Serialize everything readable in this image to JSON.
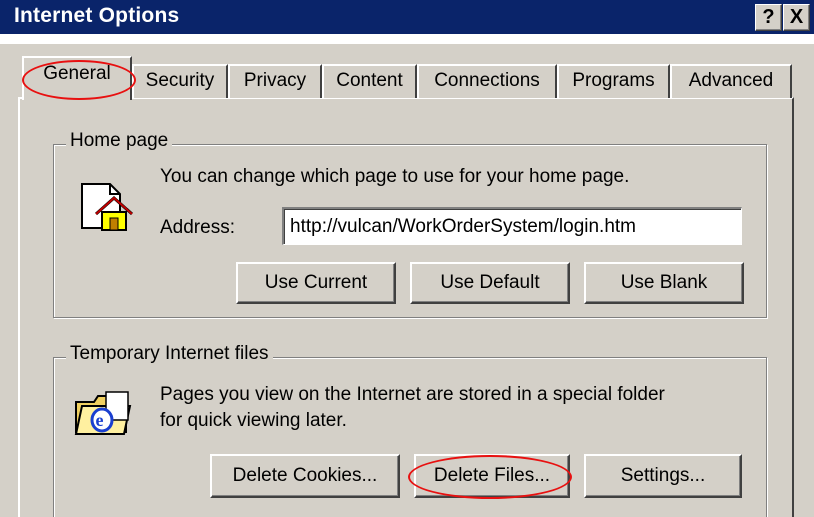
{
  "window": {
    "title": "Internet Options",
    "help_button": "?",
    "close_button": "X"
  },
  "tabs": [
    {
      "label": "General",
      "active": true
    },
    {
      "label": "Security"
    },
    {
      "label": "Privacy"
    },
    {
      "label": "Content"
    },
    {
      "label": "Connections"
    },
    {
      "label": "Programs"
    },
    {
      "label": "Advanced"
    }
  ],
  "home_page": {
    "legend": "Home page",
    "description": "You can change which page to use for your home page.",
    "address_label": "Address:",
    "address_value": "http://vulcan/WorkOrderSystem/login.htm",
    "buttons": {
      "use_current": "Use Current",
      "use_default": "Use Default",
      "use_blank": "Use Blank"
    },
    "icon": "home-page-icon"
  },
  "temp_files": {
    "legend": "Temporary Internet files",
    "description_line1": "Pages you view on the Internet are stored in a special folder",
    "description_line2": "for quick viewing later.",
    "buttons": {
      "delete_cookies": "Delete Cookies...",
      "delete_files": "Delete Files...",
      "settings": "Settings..."
    },
    "icon": "ie-folder-icon"
  },
  "colors": {
    "titlebar": "#0a246a",
    "face": "#d4d0c8",
    "highlight_circle": "#e81010"
  }
}
